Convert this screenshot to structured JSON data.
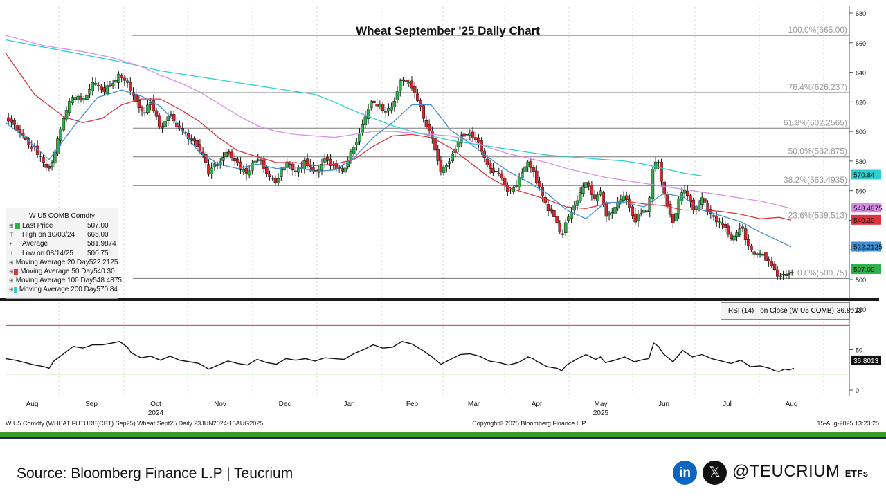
{
  "chart_data": {
    "type": "candlestick",
    "title": "Wheat September '25 Daily Chart",
    "x_months": [
      "Aug",
      "Sep",
      "Oct",
      "Nov",
      "Dec",
      "Jan",
      "Feb",
      "Mar",
      "Apr",
      "May",
      "Jun",
      "Jul",
      "Aug"
    ],
    "x_years": [
      {
        "label": "2024",
        "at": "Oct"
      },
      {
        "label": "2025",
        "at": "May"
      }
    ],
    "price_axis": {
      "ticks": [
        500,
        520,
        540,
        560,
        580,
        600,
        620,
        640,
        660,
        680
      ],
      "ylim": [
        495,
        683
      ]
    },
    "rsi_axis": {
      "ticks": [
        0,
        50,
        100
      ],
      "ylim": [
        0,
        103
      ],
      "overbought": 80,
      "oversold": 20
    },
    "fibonacci": [
      {
        "label": "100.0%(665.00)",
        "value": 665.0
      },
      {
        "label": "76.4%(626.237)",
        "value": 626.237
      },
      {
        "label": "61.8%(602.2565)",
        "value": 602.2565
      },
      {
        "label": "50.0%(582.875)",
        "value": 582.875
      },
      {
        "label": "38.2%(563.4935)",
        "value": 563.4935
      },
      {
        "label": "23.6%(539.513)",
        "value": 539.513
      },
      {
        "label": "0.0%(500.75)",
        "value": 500.75
      }
    ],
    "legend": {
      "title": "W U5 COMB Comdty",
      "items": [
        {
          "name": "Last Price",
          "value": "507.00",
          "color": "#2db34a"
        },
        {
          "name": "High on 10/03/24",
          "value": "665.00",
          "color": ""
        },
        {
          "name": "Average",
          "value": "581.9874",
          "color": ""
        },
        {
          "name": "Low on 08/14/25",
          "value": "500.75",
          "color": ""
        },
        {
          "name": "Moving Average 20 Day",
          "value": "522.2125",
          "color": "#3f8fd2"
        },
        {
          "name": "Moving Average 50 Day",
          "value": "540.30",
          "color": "#e0313c"
        },
        {
          "name": "Moving Average 100 Day",
          "value": "548.4875",
          "color": "#d98ee6"
        },
        {
          "name": "Moving Average 200 Day",
          "value": "570.84",
          "color": "#2ccfd0"
        }
      ]
    },
    "axis_labels": [
      {
        "text": "570.84",
        "value": 570.84,
        "color": "#2ccfd0"
      },
      {
        "text": "548.4875",
        "value": 548.4875,
        "color": "#d98ee6"
      },
      {
        "text": "540.30",
        "value": 540.3,
        "color": "#e0313c"
      },
      {
        "text": "522.2125",
        "value": 522.2125,
        "color": "#3f8fd2"
      },
      {
        "text": "507.00",
        "value": 507.0,
        "color": "#2db34a"
      }
    ],
    "rsi_label": {
      "prefix": "RSI (14)",
      "text": "on Close (W U5 COMB)",
      "value": "36.8013"
    },
    "rsi_last": "36.8013",
    "close_path": [
      [
        0,
        608
      ],
      [
        10,
        604
      ],
      [
        20,
        595
      ],
      [
        30,
        588
      ],
      [
        40,
        577
      ],
      [
        45,
        574
      ],
      [
        50,
        585
      ],
      [
        55,
        598
      ],
      [
        62,
        615
      ],
      [
        70,
        625
      ],
      [
        80,
        622
      ],
      [
        90,
        632
      ],
      [
        100,
        628
      ],
      [
        110,
        631
      ],
      [
        118,
        638
      ],
      [
        126,
        635
      ],
      [
        130,
        626
      ],
      [
        140,
        612
      ],
      [
        150,
        618
      ],
      [
        160,
        602
      ],
      [
        170,
        612
      ],
      [
        180,
        600
      ],
      [
        190,
        596
      ],
      [
        200,
        590
      ],
      [
        210,
        572
      ],
      [
        220,
        579
      ],
      [
        230,
        586
      ],
      [
        240,
        578
      ],
      [
        250,
        570
      ],
      [
        260,
        584
      ],
      [
        270,
        572
      ],
      [
        280,
        566
      ],
      [
        290,
        580
      ],
      [
        300,
        574
      ],
      [
        310,
        579
      ],
      [
        320,
        570
      ],
      [
        330,
        580
      ],
      [
        340,
        576
      ],
      [
        350,
        574
      ],
      [
        360,
        590
      ],
      [
        370,
        605
      ],
      [
        380,
        622
      ],
      [
        390,
        614
      ],
      [
        400,
        616
      ],
      [
        410,
        637
      ],
      [
        420,
        630
      ],
      [
        430,
        614
      ],
      [
        440,
        596
      ],
      [
        450,
        572
      ],
      [
        460,
        582
      ],
      [
        470,
        596
      ],
      [
        480,
        598
      ],
      [
        490,
        590
      ],
      [
        500,
        575
      ],
      [
        510,
        570
      ],
      [
        520,
        560
      ],
      [
        530,
        566
      ],
      [
        540,
        580
      ],
      [
        545,
        576
      ],
      [
        550,
        564
      ],
      [
        560,
        548
      ],
      [
        570,
        540
      ],
      [
        575,
        528
      ],
      [
        580,
        540
      ],
      [
        590,
        552
      ],
      [
        600,
        565
      ],
      [
        610,
        553
      ],
      [
        615,
        560
      ],
      [
        620,
        544
      ],
      [
        630,
        548
      ],
      [
        640,
        556
      ],
      [
        650,
        540
      ],
      [
        660,
        546
      ],
      [
        665,
        548
      ],
      [
        670,
        583
      ],
      [
        675,
        578
      ],
      [
        680,
        560
      ],
      [
        690,
        538
      ],
      [
        700,
        562
      ],
      [
        710,
        548
      ],
      [
        720,
        554
      ],
      [
        730,
        544
      ],
      [
        740,
        537
      ],
      [
        750,
        528
      ],
      [
        760,
        536
      ],
      [
        770,
        519
      ],
      [
        780,
        519
      ],
      [
        790,
        512
      ],
      [
        795,
        506
      ],
      [
        800,
        502
      ],
      [
        805,
        505
      ],
      [
        810,
        503
      ],
      [
        815,
        507
      ]
    ],
    "ma20": [
      [
        0,
        606
      ],
      [
        20,
        596
      ],
      [
        45,
        581
      ],
      [
        70,
        603
      ],
      [
        95,
        623
      ],
      [
        120,
        628
      ],
      [
        140,
        624
      ],
      [
        160,
        617
      ],
      [
        180,
        603
      ],
      [
        200,
        586
      ],
      [
        220,
        578
      ],
      [
        240,
        575
      ],
      [
        260,
        578
      ],
      [
        280,
        575
      ],
      [
        300,
        576
      ],
      [
        320,
        573
      ],
      [
        340,
        574
      ],
      [
        360,
        582
      ],
      [
        380,
        596
      ],
      [
        400,
        606
      ],
      [
        420,
        618
      ],
      [
        440,
        618
      ],
      [
        460,
        601
      ],
      [
        480,
        592
      ],
      [
        500,
        582
      ],
      [
        520,
        573
      ],
      [
        540,
        566
      ],
      [
        560,
        558
      ],
      [
        580,
        547
      ],
      [
        600,
        541
      ],
      [
        620,
        552
      ],
      [
        640,
        552
      ],
      [
        660,
        549
      ],
      [
        680,
        558
      ],
      [
        700,
        556
      ],
      [
        720,
        547
      ],
      [
        740,
        543
      ],
      [
        760,
        539
      ],
      [
        780,
        532
      ],
      [
        800,
        526
      ],
      [
        812,
        522
      ]
    ],
    "ma50": [
      [
        0,
        653
      ],
      [
        30,
        625
      ],
      [
        60,
        610
      ],
      [
        80,
        606
      ],
      [
        100,
        609
      ],
      [
        120,
        618
      ],
      [
        140,
        622
      ],
      [
        160,
        622
      ],
      [
        180,
        615
      ],
      [
        200,
        607
      ],
      [
        220,
        596
      ],
      [
        240,
        587
      ],
      [
        260,
        583
      ],
      [
        280,
        579
      ],
      [
        300,
        579
      ],
      [
        320,
        577
      ],
      [
        340,
        578
      ],
      [
        360,
        581
      ],
      [
        380,
        590
      ],
      [
        400,
        597
      ],
      [
        420,
        598
      ],
      [
        440,
        596
      ],
      [
        460,
        589
      ],
      [
        480,
        579
      ],
      [
        500,
        569
      ],
      [
        520,
        562
      ],
      [
        540,
        558
      ],
      [
        560,
        554
      ],
      [
        580,
        549
      ],
      [
        600,
        548
      ],
      [
        620,
        551
      ],
      [
        640,
        553
      ],
      [
        660,
        551
      ],
      [
        680,
        550
      ],
      [
        700,
        547
      ],
      [
        720,
        547
      ],
      [
        740,
        546
      ],
      [
        760,
        544
      ],
      [
        780,
        541
      ],
      [
        800,
        542
      ],
      [
        812,
        540
      ]
    ],
    "ma100": [
      [
        0,
        665
      ],
      [
        40,
        658
      ],
      [
        80,
        654
      ],
      [
        110,
        650
      ],
      [
        140,
        644
      ],
      [
        160,
        638
      ],
      [
        180,
        633
      ],
      [
        200,
        627
      ],
      [
        220,
        619
      ],
      [
        240,
        611
      ],
      [
        260,
        604
      ],
      [
        280,
        600
      ],
      [
        300,
        598
      ],
      [
        320,
        597
      ],
      [
        340,
        596
      ],
      [
        360,
        598
      ],
      [
        380,
        600
      ],
      [
        400,
        600
      ],
      [
        420,
        599
      ],
      [
        440,
        598
      ],
      [
        460,
        597
      ],
      [
        480,
        594
      ],
      [
        500,
        589
      ],
      [
        520,
        585
      ],
      [
        540,
        582
      ],
      [
        560,
        579
      ],
      [
        580,
        575
      ],
      [
        600,
        572
      ],
      [
        620,
        569
      ],
      [
        640,
        567
      ],
      [
        660,
        565
      ],
      [
        680,
        563
      ],
      [
        700,
        561
      ],
      [
        720,
        559
      ],
      [
        740,
        557
      ],
      [
        760,
        555
      ],
      [
        780,
        553
      ],
      [
        800,
        550
      ],
      [
        812,
        548
      ]
    ],
    "ma200": [
      [
        0,
        662
      ],
      [
        40,
        657
      ],
      [
        80,
        652
      ],
      [
        120,
        647
      ],
      [
        160,
        641
      ],
      [
        200,
        637
      ],
      [
        240,
        633
      ],
      [
        280,
        629
      ],
      [
        320,
        625
      ],
      [
        340,
        620
      ],
      [
        360,
        614
      ],
      [
        380,
        609
      ],
      [
        400,
        604
      ],
      [
        420,
        600
      ],
      [
        440,
        597
      ],
      [
        460,
        594
      ],
      [
        480,
        592
      ],
      [
        500,
        590
      ],
      [
        520,
        588
      ],
      [
        540,
        586
      ],
      [
        560,
        584
      ],
      [
        580,
        583
      ],
      [
        600,
        582
      ],
      [
        620,
        581
      ],
      [
        640,
        580
      ],
      [
        660,
        578
      ],
      [
        680,
        575
      ],
      [
        700,
        572
      ],
      [
        720,
        570
      ]
    ],
    "rsi": [
      [
        0,
        39
      ],
      [
        10,
        37
      ],
      [
        20,
        34
      ],
      [
        30,
        31
      ],
      [
        40,
        29
      ],
      [
        45,
        27
      ],
      [
        50,
        36
      ],
      [
        60,
        45
      ],
      [
        70,
        54
      ],
      [
        80,
        52
      ],
      [
        90,
        56
      ],
      [
        100,
        56
      ],
      [
        110,
        58
      ],
      [
        118,
        60
      ],
      [
        126,
        53
      ],
      [
        130,
        46
      ],
      [
        140,
        40
      ],
      [
        150,
        42
      ],
      [
        160,
        37
      ],
      [
        170,
        42
      ],
      [
        180,
        37
      ],
      [
        190,
        35
      ],
      [
        200,
        33
      ],
      [
        210,
        26
      ],
      [
        220,
        31
      ],
      [
        230,
        36
      ],
      [
        240,
        33
      ],
      [
        250,
        31
      ],
      [
        260,
        38
      ],
      [
        270,
        34
      ],
      [
        280,
        32
      ],
      [
        290,
        39
      ],
      [
        300,
        37
      ],
      [
        310,
        39
      ],
      [
        320,
        36
      ],
      [
        330,
        40
      ],
      [
        340,
        39
      ],
      [
        350,
        38
      ],
      [
        360,
        45
      ],
      [
        370,
        50
      ],
      [
        380,
        56
      ],
      [
        390,
        52
      ],
      [
        400,
        53
      ],
      [
        410,
        60
      ],
      [
        420,
        57
      ],
      [
        430,
        50
      ],
      [
        440,
        42
      ],
      [
        450,
        32
      ],
      [
        460,
        38
      ],
      [
        470,
        44
      ],
      [
        480,
        45
      ],
      [
        490,
        42
      ],
      [
        500,
        36
      ],
      [
        510,
        34
      ],
      [
        520,
        31
      ],
      [
        530,
        34
      ],
      [
        540,
        41
      ],
      [
        545,
        39
      ],
      [
        550,
        35
      ],
      [
        560,
        29
      ],
      [
        570,
        27
      ],
      [
        575,
        24
      ],
      [
        580,
        31
      ],
      [
        590,
        38
      ],
      [
        600,
        44
      ],
      [
        610,
        38
      ],
      [
        615,
        41
      ],
      [
        620,
        34
      ],
      [
        630,
        37
      ],
      [
        640,
        41
      ],
      [
        650,
        35
      ],
      [
        660,
        38
      ],
      [
        665,
        39
      ],
      [
        670,
        58
      ],
      [
        675,
        54
      ],
      [
        680,
        45
      ],
      [
        690,
        35
      ],
      [
        700,
        49
      ],
      [
        710,
        41
      ],
      [
        720,
        44
      ],
      [
        730,
        39
      ],
      [
        740,
        36
      ],
      [
        750,
        33
      ],
      [
        760,
        37
      ],
      [
        770,
        29
      ],
      [
        780,
        30
      ],
      [
        790,
        27
      ],
      [
        795,
        24
      ],
      [
        800,
        23
      ],
      [
        805,
        26
      ],
      [
        810,
        25
      ],
      [
        815,
        27
      ]
    ],
    "footer_left": "W U5 Comdty (WHEAT FUTURE(CBT) Sep25) Wheat Sept25  Daily 23JUN2024-15AUG2025",
    "footer_center": "Copyright© 2025 Bloomberg Finance L.P.",
    "footer_right": "15-Aug-2025 13:23:25"
  },
  "colors": {
    "up": "#2db34a",
    "down": "#d9262c",
    "fib": "#7a7a7a",
    "divider": "#1a1a1a",
    "green_rule": "#3a9a2a"
  },
  "footer": {
    "source": "Source: Bloomberg Finance L.P | Teucrium",
    "linkedin_icon": "in",
    "x_icon": "𝕏",
    "brand": "@TEUCRIUM",
    "brand_suffix": "ETFs"
  }
}
